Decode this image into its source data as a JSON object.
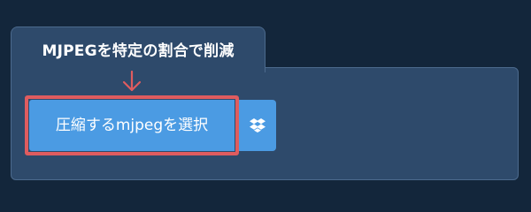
{
  "tab": {
    "title": "MJPEGを特定の割合で削減"
  },
  "upload": {
    "select_button_label": "圧縮するmjpegを選択",
    "dropbox_icon": "dropbox-icon"
  },
  "annotations": {
    "arrow_icon": "arrow-down-icon",
    "highlight_color": "#df5c5f"
  },
  "colors": {
    "background": "#13263b",
    "panel": "#2e4a6b",
    "button": "#4b9be3"
  }
}
